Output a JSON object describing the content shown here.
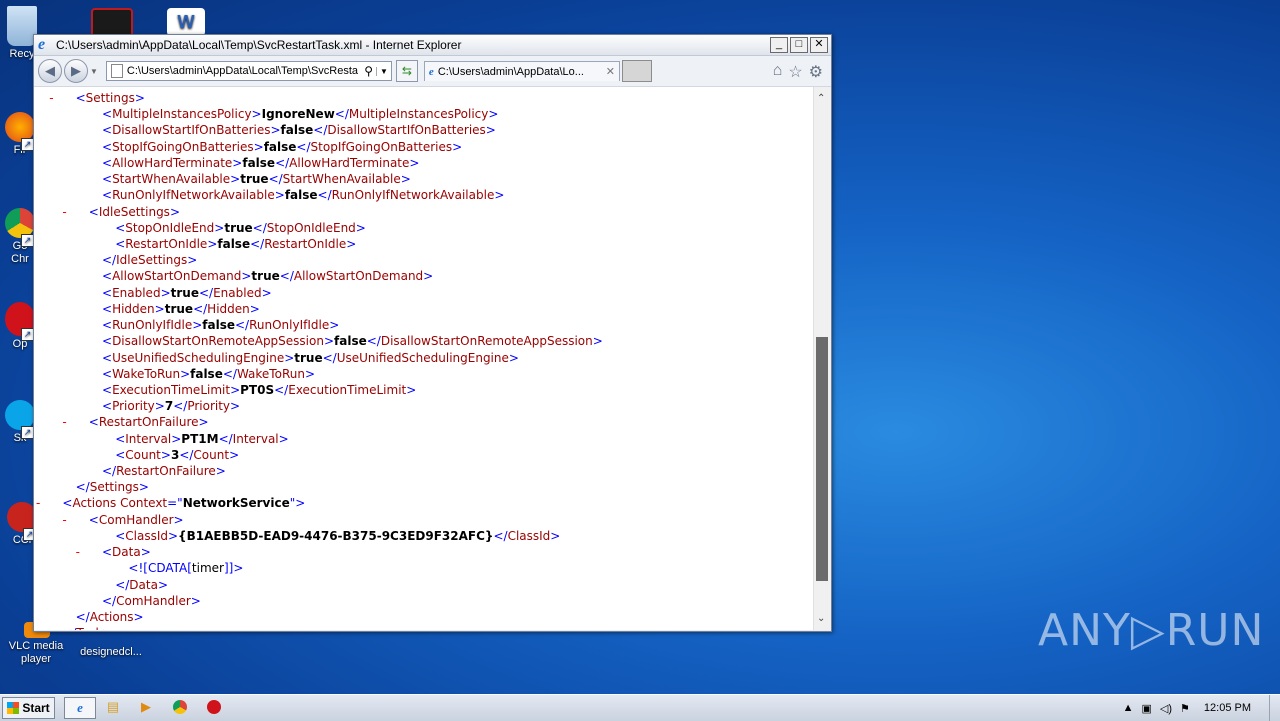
{
  "desktop": {
    "icons": [
      {
        "label": "Recy"
      },
      {
        "label": ""
      },
      {
        "label": ""
      },
      {
        "label": "Fir"
      },
      {
        "label": "Go\nChr"
      },
      {
        "label": "Op"
      },
      {
        "label": "Sk"
      },
      {
        "label": "CCl"
      },
      {
        "label": "VLC media\nplayer"
      },
      {
        "label": "designedcl..."
      }
    ],
    "watermark": "ANY▷RUN"
  },
  "window": {
    "title": "C:\\Users\\admin\\AppData\\Local\\Temp\\SvcRestartTask.xml - Internet Explorer",
    "address": "C:\\Users\\admin\\AppData\\Local\\Temp\\SvcResta",
    "tab_title": "C:\\Users\\admin\\AppData\\Lo...",
    "minimize": "_",
    "maximize": "□",
    "close": "✕"
  },
  "xml_lines": [
    {
      "i": 3,
      "m": "-",
      "open": "Settings"
    },
    {
      "i": 5,
      "tag": "MultipleInstancesPolicy",
      "val": "IgnoreNew"
    },
    {
      "i": 5,
      "tag": "DisallowStartIfOnBatteries",
      "val": "false"
    },
    {
      "i": 5,
      "tag": "StopIfGoingOnBatteries",
      "val": "false"
    },
    {
      "i": 5,
      "tag": "AllowHardTerminate",
      "val": "false"
    },
    {
      "i": 5,
      "tag": "StartWhenAvailable",
      "val": "true"
    },
    {
      "i": 5,
      "tag": "RunOnlyIfNetworkAvailable",
      "val": "false"
    },
    {
      "i": 4,
      "m": "-",
      "open": "IdleSettings"
    },
    {
      "i": 6,
      "tag": "StopOnIdleEnd",
      "val": "true"
    },
    {
      "i": 6,
      "tag": "RestartOnIdle",
      "val": "false"
    },
    {
      "i": 5,
      "close": "IdleSettings"
    },
    {
      "i": 5,
      "tag": "AllowStartOnDemand",
      "val": "true"
    },
    {
      "i": 5,
      "tag": "Enabled",
      "val": "true"
    },
    {
      "i": 5,
      "tag": "Hidden",
      "val": "true"
    },
    {
      "i": 5,
      "tag": "RunOnlyIfIdle",
      "val": "false"
    },
    {
      "i": 5,
      "tag": "DisallowStartOnRemoteAppSession",
      "val": "false"
    },
    {
      "i": 5,
      "tag": "UseUnifiedSchedulingEngine",
      "val": "true"
    },
    {
      "i": 5,
      "tag": "WakeToRun",
      "val": "false"
    },
    {
      "i": 5,
      "tag": "ExecutionTimeLimit",
      "val": "PT0S"
    },
    {
      "i": 5,
      "tag": "Priority",
      "val": "7"
    },
    {
      "i": 4,
      "m": "-",
      "open": "RestartOnFailure"
    },
    {
      "i": 6,
      "tag": "Interval",
      "val": "PT1M"
    },
    {
      "i": 6,
      "tag": "Count",
      "val": "3"
    },
    {
      "i": 5,
      "close": "RestartOnFailure"
    },
    {
      "i": 3,
      "close": "Settings"
    },
    {
      "i": 2,
      "m": "-",
      "open": "Actions",
      "attr": "Context",
      "attrval": "NetworkService"
    },
    {
      "i": 4,
      "m": "-",
      "open": "ComHandler"
    },
    {
      "i": 6,
      "tag": "ClassId",
      "val": "{B1AEBB5D-EAD9-4476-B375-9C3ED9F32AFC}"
    },
    {
      "i": 5,
      "m": "-",
      "open": "Data"
    },
    {
      "i": 7,
      "cdata": "timer"
    },
    {
      "i": 6,
      "close": "Data"
    },
    {
      "i": 5,
      "close": "ComHandler"
    },
    {
      "i": 3,
      "close": "Actions"
    },
    {
      "i": 2,
      "close": "Task"
    }
  ],
  "taskbar": {
    "start": "Start",
    "time": "12:05 PM"
  }
}
